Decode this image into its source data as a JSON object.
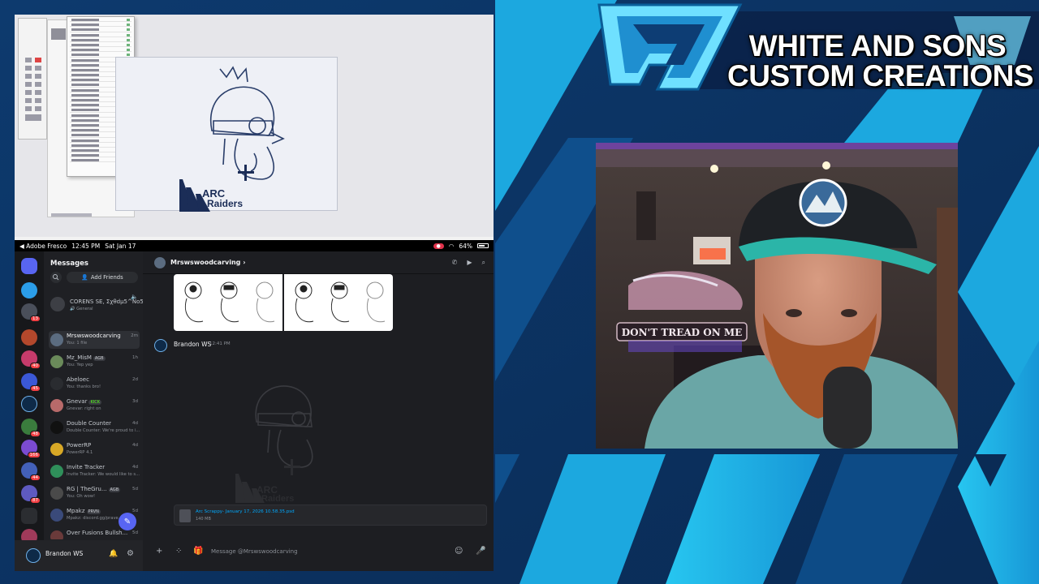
{
  "stream": {
    "title_line1": "WHITE AND SONS",
    "title_line2": "CUSTOM CREATIONS",
    "colors": {
      "accent": "#1fb3e8",
      "dark": "#0b2a52",
      "navy": "#072042"
    }
  },
  "ipad_status": {
    "back_app": "◀ Adobe Fresco",
    "time": "12:45 PM",
    "date": "Sat Jan 17",
    "battery": "64%"
  },
  "fresco_art": {
    "logo_line1": "ARC",
    "logo_line2": "Raiders"
  },
  "discord": {
    "messages_title": "Messages",
    "add_friends_label": "Add Friends",
    "guild_badges": [
      "13",
      "40",
      "45",
      "48",
      "166",
      "44",
      "87"
    ],
    "dms": [
      {
        "name": "CORENS SE, Σχθdμ5^No51...",
        "sub": "🔊 General",
        "time": ""
      },
      {
        "name": "Mrswswoodcarving",
        "sub": "You: 1 file",
        "time": "2m"
      },
      {
        "name": "Mz_MisM",
        "tag": "AGB",
        "sub": "You: Yep yep",
        "time": "1h"
      },
      {
        "name": "Abeloec",
        "sub": "You: thanks bro!",
        "time": "2d"
      },
      {
        "name": "Gnevar",
        "tag": "KICK",
        "sub": "Gnevar: right on",
        "time": "3d"
      },
      {
        "name": "Double Counter",
        "sub": "Double Counter: We're proud to i...",
        "time": "4d"
      },
      {
        "name": "PowerRP",
        "sub": "PowerRP 4.1",
        "time": "4d"
      },
      {
        "name": "Invite Tracker",
        "sub": "Invite Tracker: We would like to s...",
        "time": "4d"
      },
      {
        "name": "RG | TheGru...",
        "tag": "AGB",
        "sub": "You: Oh wow!",
        "time": "5d"
      },
      {
        "name": "Mpakz",
        "tag": "PRVN",
        "sub": "Mpakz: discord.gg/prave...",
        "time": "5d"
      },
      {
        "name": "Over Fusions Bullsh...",
        "sub": "",
        "time": "5d"
      }
    ],
    "current_user": "Brandon WS",
    "chat": {
      "channel_name": "Mrswswoodcarving",
      "message_author": "Brandon WS",
      "message_time": "12:41 PM",
      "file_name": "Arc Scrappy- January 17, 2026 10.58.35.psd",
      "file_size": "140 MB",
      "composer_placeholder": "Message @Mrswswoodcarving"
    }
  },
  "webcam": {
    "sign_text": "DON'T TREAD ON ME"
  }
}
